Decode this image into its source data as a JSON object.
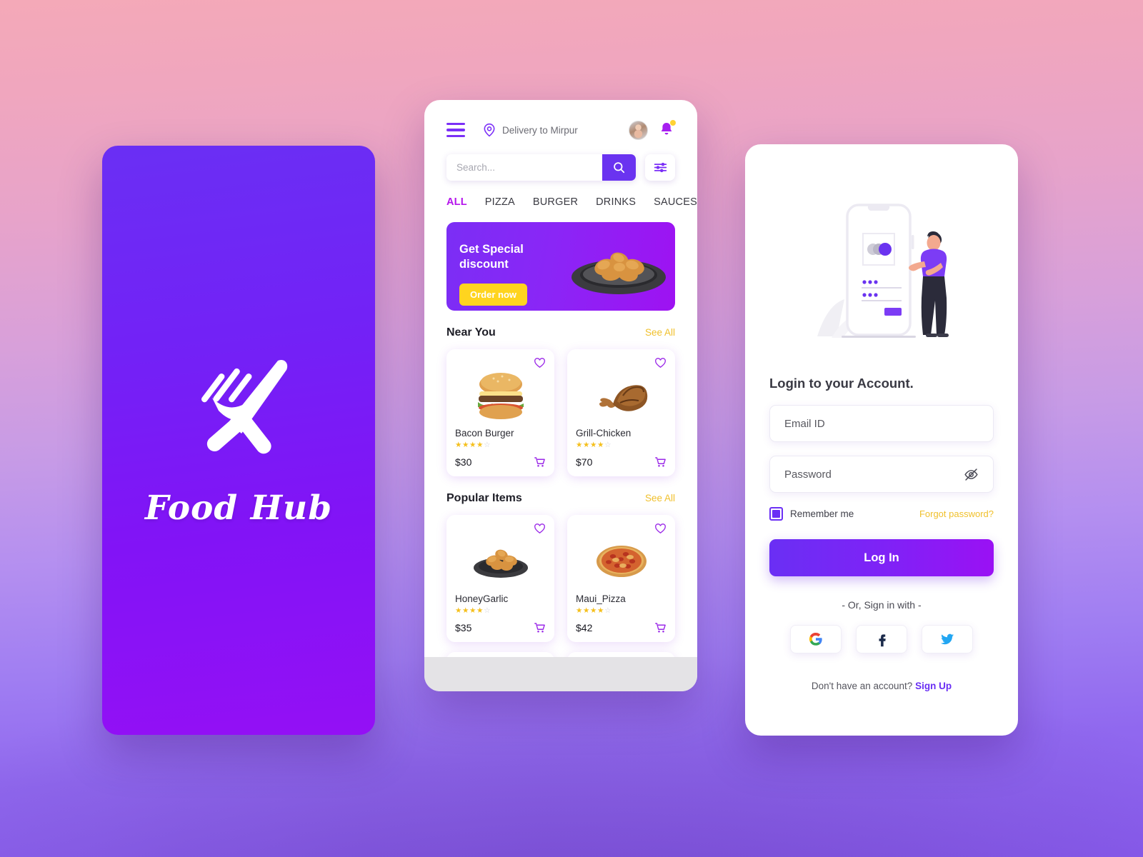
{
  "splash": {
    "brand_name": "Food Hub",
    "logo_icon": "fork-knife-cross-icon",
    "bg_top": "#6a2ff4",
    "bg_bottom": "#9410f5"
  },
  "app": {
    "topbar": {
      "menu_icon": "hamburger-menu-icon",
      "location_icon": "map-pin-icon",
      "location_text": "Delivery to Mirpur",
      "avatar_icon": "user-avatar",
      "bell_icon": "notification-bell-icon",
      "bell_badge_color": "#ffd233"
    },
    "search": {
      "placeholder": "Search...",
      "value": "",
      "search_icon": "magnifier-icon",
      "filter_icon": "sliders-filter-icon",
      "button_color": "#6a33f0"
    },
    "categories": [
      {
        "label": "ALL",
        "active": true
      },
      {
        "label": "PIZZA",
        "active": false
      },
      {
        "label": "BURGER",
        "active": false
      },
      {
        "label": "DRINKS",
        "active": false
      },
      {
        "label": "SAUCES",
        "active": false
      }
    ],
    "active_category_color": "#b514ec",
    "banner": {
      "title_line1": "Get Special",
      "title_line2": "discount",
      "cta_label": "Order now",
      "cta_color": "#ffd41f",
      "food_icon": "fried-chicken-platter"
    },
    "sections": [
      {
        "title": "Near You",
        "see_all": "See All",
        "items": [
          {
            "name": "Bacon Burger",
            "price": "$30",
            "rating": 4,
            "rating_max": 5,
            "image_icon": "burger-image",
            "heart_icon": "heart-outline-icon",
            "cart_icon": "shopping-cart-icon"
          },
          {
            "name": "Grill-Chicken",
            "price": "$70",
            "rating": 4,
            "rating_max": 5,
            "image_icon": "grilled-chicken-image",
            "heart_icon": "heart-outline-icon",
            "cart_icon": "shopping-cart-icon"
          }
        ]
      },
      {
        "title": "Popular Items",
        "see_all": "See All",
        "items": [
          {
            "name": "HoneyGarlic",
            "price": "$35",
            "rating": 4,
            "rating_max": 5,
            "image_icon": "honey-garlic-chicken-image",
            "heart_icon": "heart-outline-icon",
            "cart_icon": "shopping-cart-icon"
          },
          {
            "name": "Maui_Pizza",
            "price": "$42",
            "rating": 4,
            "rating_max": 5,
            "image_icon": "pizza-image",
            "heart_icon": "heart-outline-icon",
            "cart_icon": "shopping-cart-icon"
          }
        ]
      }
    ],
    "see_all_color": "#f0c02c"
  },
  "login": {
    "illustration_icon": "phone-login-illustration",
    "title": "Login to your Account.",
    "email": {
      "placeholder": "Email ID",
      "value": ""
    },
    "password": {
      "placeholder": "Password",
      "value": "",
      "toggle_icon": "eye-off-icon"
    },
    "remember": {
      "label": "Remember me",
      "checked": true
    },
    "forgot_label": "Forgot password?",
    "submit_label": "Log In",
    "or_label": "- Or, Sign in with -",
    "socials": [
      {
        "name": "google",
        "icon": "google-g-icon"
      },
      {
        "name": "facebook",
        "icon": "facebook-f-icon"
      },
      {
        "name": "twitter",
        "icon": "twitter-bird-icon"
      }
    ],
    "signup_prompt": "Don't have an account?",
    "signup_label": "Sign Up",
    "accent_color": "#6a2ff4",
    "link_color": "#f0c02c"
  }
}
